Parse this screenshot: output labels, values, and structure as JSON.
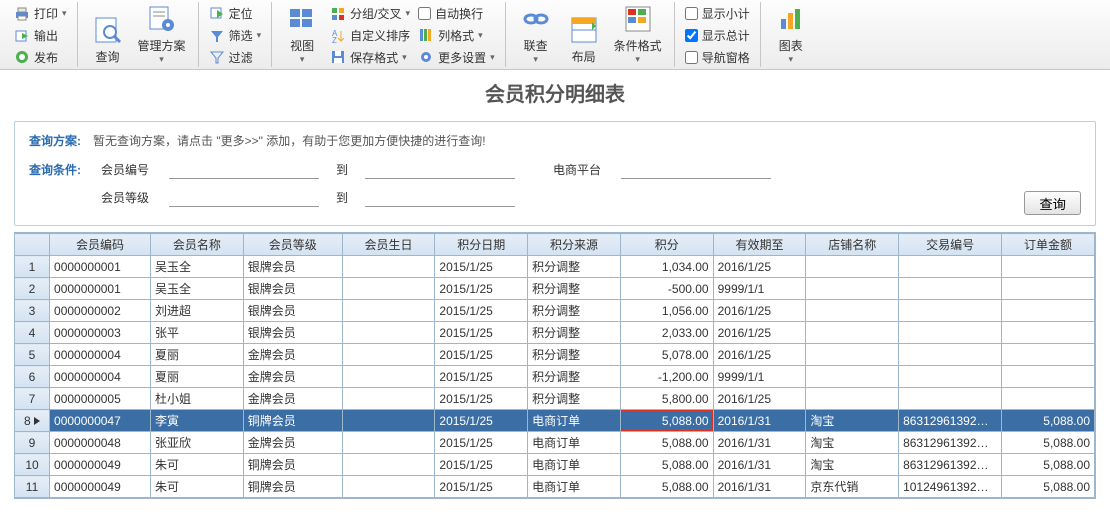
{
  "toolbar": {
    "small1": {
      "print": "打印",
      "export": "输出",
      "publish": "发布"
    },
    "big": {
      "search": "查询",
      "plan": "管理方案",
      "view": "视图",
      "link": "联查",
      "layout": "布局",
      "condfmt": "条件格式",
      "chart": "图表"
    },
    "small2": {
      "locate": "定位",
      "filter": "筛选",
      "filter2": "过滤"
    },
    "small3": {
      "group": "分组/交叉",
      "sort": "自定义排序",
      "savefmt": "保存格式"
    },
    "small4": {
      "autowrap": "自动换行",
      "colfmt": "列格式",
      "more": "更多设置"
    },
    "small5": {
      "subtotal": "显示小计",
      "total": "显示总计",
      "navwin": "导航窗格"
    }
  },
  "page_title": "会员积分明细表",
  "query": {
    "plan_label": "查询方案:",
    "plan_text": "暂无查询方案，请点击 \"更多>>\" 添加，有助于您更加方便快捷的进行查询!",
    "cond_label": "查询条件:",
    "f_member": "会员编号",
    "f_to": "到",
    "f_platform": "电商平台",
    "f_level": "会员等级",
    "btn": "查询"
  },
  "grid": {
    "headers": [
      "会员编码",
      "会员名称",
      "会员等级",
      "会员生日",
      "积分日期",
      "积分来源",
      "积分",
      "有效期至",
      "店铺名称",
      "交易编号",
      "订单金额"
    ],
    "rows": [
      {
        "n": "1",
        "code": "0000000001",
        "name": "吴玉全",
        "lvl": "银牌会员",
        "bd": "",
        "date": "2015/1/25",
        "src": "积分调整",
        "pts": "1,034.00",
        "exp": "2016/1/25",
        "shop": "",
        "txn": "",
        "amt": ""
      },
      {
        "n": "2",
        "code": "0000000001",
        "name": "吴玉全",
        "lvl": "银牌会员",
        "bd": "",
        "date": "2015/1/25",
        "src": "积分调整",
        "pts": "-500.00",
        "exp": "9999/1/1",
        "shop": "",
        "txn": "",
        "amt": ""
      },
      {
        "n": "3",
        "code": "0000000002",
        "name": "刘进超",
        "lvl": "银牌会员",
        "bd": "",
        "date": "2015/1/25",
        "src": "积分调整",
        "pts": "1,056.00",
        "exp": "2016/1/25",
        "shop": "",
        "txn": "",
        "amt": ""
      },
      {
        "n": "4",
        "code": "0000000003",
        "name": "张平",
        "lvl": "银牌会员",
        "bd": "",
        "date": "2015/1/25",
        "src": "积分调整",
        "pts": "2,033.00",
        "exp": "2016/1/25",
        "shop": "",
        "txn": "",
        "amt": ""
      },
      {
        "n": "5",
        "code": "0000000004",
        "name": "夏丽",
        "lvl": "金牌会员",
        "bd": "",
        "date": "2015/1/25",
        "src": "积分调整",
        "pts": "5,078.00",
        "exp": "2016/1/25",
        "shop": "",
        "txn": "",
        "amt": ""
      },
      {
        "n": "6",
        "code": "0000000004",
        "name": "夏丽",
        "lvl": "金牌会员",
        "bd": "",
        "date": "2015/1/25",
        "src": "积分调整",
        "pts": "-1,200.00",
        "exp": "9999/1/1",
        "shop": "",
        "txn": "",
        "amt": ""
      },
      {
        "n": "7",
        "code": "0000000005",
        "name": "杜小姐",
        "lvl": "金牌会员",
        "bd": "",
        "date": "2015/1/25",
        "src": "积分调整",
        "pts": "5,800.00",
        "exp": "2016/1/25",
        "shop": "",
        "txn": "",
        "amt": ""
      },
      {
        "n": "8",
        "code": "0000000047",
        "name": "李寅",
        "lvl": "铜牌会员",
        "bd": "",
        "date": "2015/1/25",
        "src": "电商订单",
        "pts": "5,088.00",
        "exp": "2016/1/31",
        "shop": "淘宝",
        "txn": "86312961392…",
        "amt": "5,088.00",
        "sel": true,
        "hl": true
      },
      {
        "n": "9",
        "code": "0000000048",
        "name": "张亚欣",
        "lvl": "金牌会员",
        "bd": "",
        "date": "2015/1/25",
        "src": "电商订单",
        "pts": "5,088.00",
        "exp": "2016/1/31",
        "shop": "淘宝",
        "txn": "86312961392…",
        "amt": "5,088.00"
      },
      {
        "n": "10",
        "code": "0000000049",
        "name": "朱可",
        "lvl": "铜牌会员",
        "bd": "",
        "date": "2015/1/25",
        "src": "电商订单",
        "pts": "5,088.00",
        "exp": "2016/1/31",
        "shop": "淘宝",
        "txn": "86312961392…",
        "amt": "5,088.00"
      },
      {
        "n": "11",
        "code": "0000000049",
        "name": "朱可",
        "lvl": "铜牌会员",
        "bd": "",
        "date": "2015/1/25",
        "src": "电商订单",
        "pts": "5,088.00",
        "exp": "2016/1/31",
        "shop": "京东代销",
        "txn": "10124961392…",
        "amt": "5,088.00"
      }
    ]
  }
}
